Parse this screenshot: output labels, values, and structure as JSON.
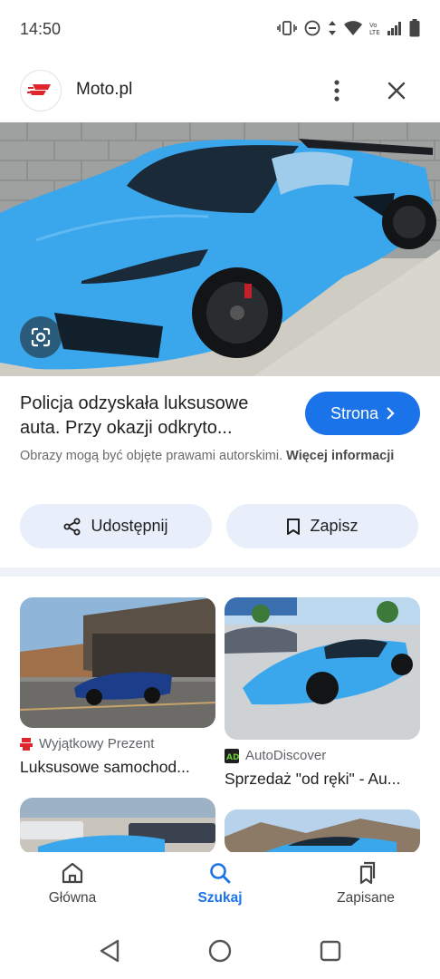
{
  "status_bar": {
    "time": "14:50",
    "icons": [
      "vibrate-icon",
      "do-not-disturb-icon",
      "data-arrows-icon",
      "wifi-icon",
      "volte-icon",
      "signal-icon",
      "battery-icon"
    ]
  },
  "header": {
    "site_name": "Moto.pl",
    "logo_color": "#e0262d"
  },
  "result": {
    "title_line1": "Policja odzyskała luksusowe",
    "title_line2": "auta. Przy okazji odkryto...",
    "visit_label": "Strona",
    "copyright_text": "Obrazy mogą być objęte prawami autorskimi.",
    "more_info_label": "Więcej informacji"
  },
  "actions": {
    "share_label": "Udostępnij",
    "save_label": "Zapisz"
  },
  "related": [
    {
      "source": "Wyjątkowy Prezent",
      "title": "Luksusowe samochod...",
      "source_color": "#e0262d"
    },
    {
      "source": "AutoDiscover",
      "title": "Sprzedaż \"od ręki\" - Au...",
      "source_color": "#1f1f1f"
    }
  ],
  "bottom_nav": {
    "items": [
      {
        "label": "Główna"
      },
      {
        "label": "Szukaj"
      },
      {
        "label": "Zapisane"
      }
    ],
    "active_color": "#1a73e8"
  },
  "colors": {
    "accent": "#1a73e8",
    "chip_background": "#e8effa",
    "car_blue": "#3aa6ec"
  }
}
